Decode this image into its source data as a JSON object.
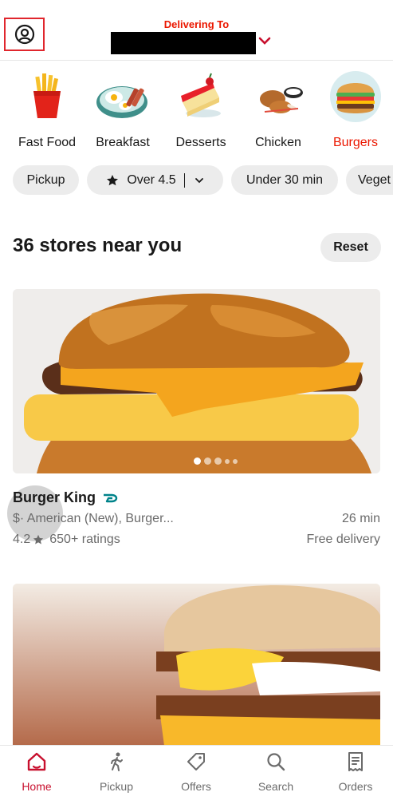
{
  "header": {
    "delivering_label": "Delivering To",
    "account_icon": "account-circle-icon"
  },
  "categories": [
    {
      "label": "Fast Food",
      "icon": "fries-icon",
      "active": false
    },
    {
      "label": "Breakfast",
      "icon": "breakfast-plate-icon",
      "active": false
    },
    {
      "label": "Desserts",
      "icon": "cake-slice-icon",
      "active": false
    },
    {
      "label": "Chicken",
      "icon": "fried-chicken-icon",
      "active": false
    },
    {
      "label": "Burgers",
      "icon": "burger-icon",
      "active": true
    }
  ],
  "filters": [
    {
      "label": "Pickup"
    },
    {
      "label": "Over 4.5"
    },
    {
      "label": "Under 30 min"
    },
    {
      "label": "Veget"
    }
  ],
  "stores": {
    "title": "36 stores near you",
    "reset_label": "Reset",
    "items": [
      {
        "name": "Burger King",
        "meta": "$· American (New), Burger...",
        "time": "26 min",
        "rating": "4.2",
        "ratings_count": "650+ ratings",
        "fee": "Free delivery",
        "image_dots": 5,
        "active_dot": 1
      }
    ]
  },
  "nav": {
    "home": "Home",
    "pickup": "Pickup",
    "offers": "Offers",
    "search": "Search",
    "orders": "Orders"
  },
  "colors": {
    "brand_red": "#eb1700",
    "active_nav": "#c8102e",
    "chip_bg": "#ececec",
    "secondary_text": "#6b6b6b"
  }
}
